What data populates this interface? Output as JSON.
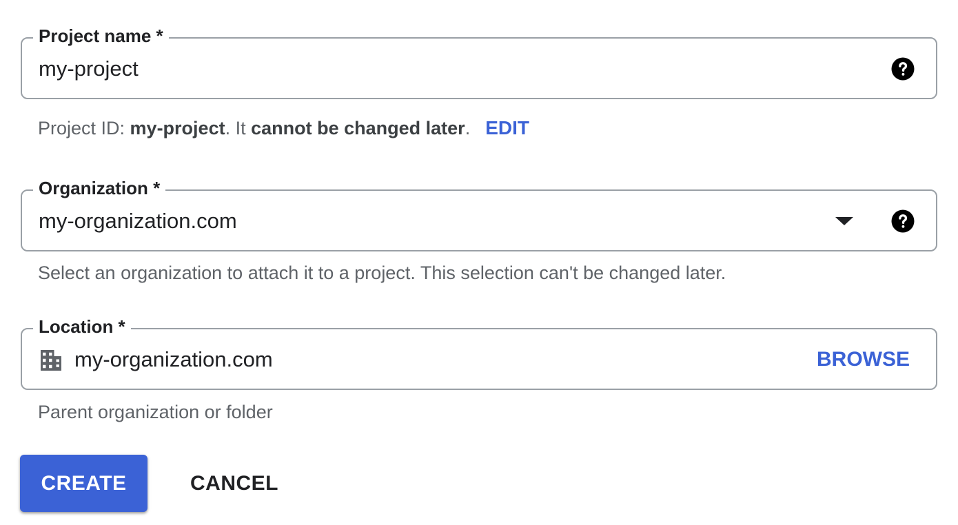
{
  "project_name": {
    "label": "Project name *",
    "value": "my-project",
    "help_icon": "help-circle-icon"
  },
  "project_id_note": {
    "prefix": "Project ID: ",
    "project_id": "my-project",
    "middle": ". It ",
    "emphasis": "cannot be changed later",
    "suffix": ".",
    "edit_label": "EDIT"
  },
  "organization": {
    "label": "Organization *",
    "value": "my-organization.com",
    "dropdown_icon": "arrow-drop-down-icon",
    "help_icon": "help-circle-icon",
    "helper": "Select an organization to attach it to a project. This selection can't be changed later."
  },
  "location": {
    "label": "Location *",
    "value": "my-organization.com",
    "icon": "organization-building-icon",
    "browse_label": "BROWSE",
    "helper": "Parent organization or folder"
  },
  "actions": {
    "create_label": "CREATE",
    "cancel_label": "CANCEL"
  },
  "colors": {
    "primary": "#3b62d6",
    "border": "#9aa0a6",
    "helper_text": "#5f6368",
    "text": "#202124"
  }
}
